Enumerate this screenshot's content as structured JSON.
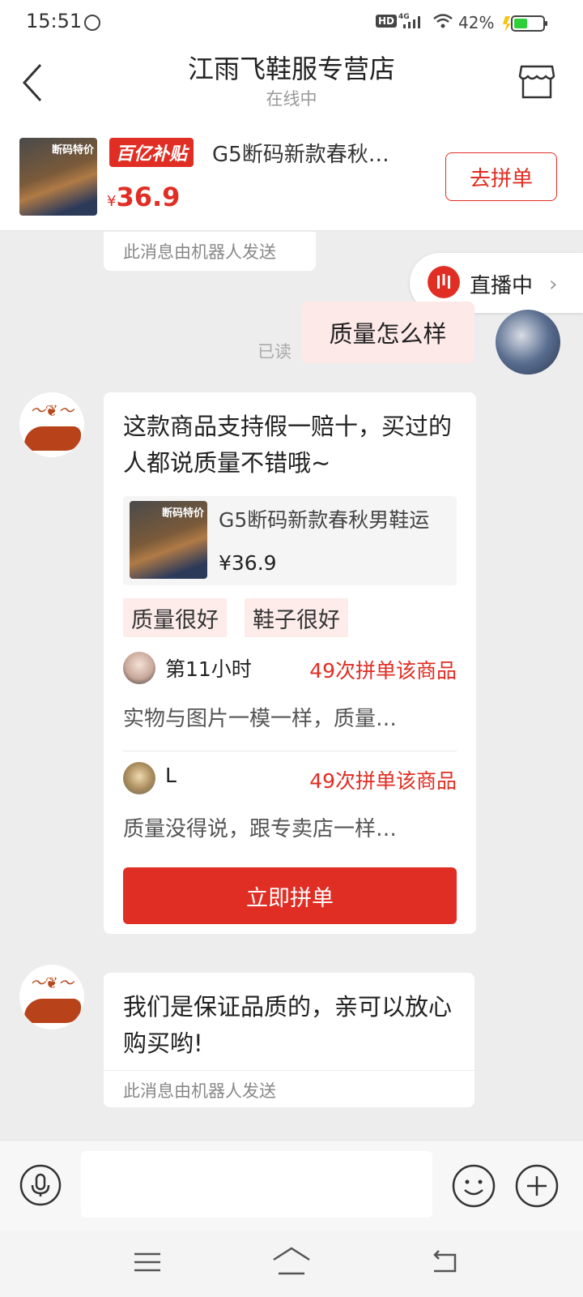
{
  "status_bar": {
    "time": "15:51",
    "network": "4G",
    "hd_label": "HD",
    "battery_percent": "42%"
  },
  "header": {
    "title": "江雨飞鞋服专营店",
    "subtitle": "在线中"
  },
  "product": {
    "thumb_tag": "断码特价",
    "badge": "百亿补贴",
    "title": "G5断码新款春秋…",
    "currency": "¥",
    "price": "36.9",
    "button_label": "去拼单"
  },
  "messages": {
    "robot_note": "此消息由机器人发送",
    "live": {
      "label": "直播中"
    },
    "my_message": {
      "text": "质量怎么样",
      "status": "已读"
    },
    "product_card": {
      "text": "这款商品支持假一赔十，买过的人都说质量不错哦~",
      "thumb_tag": "断码特价",
      "product_title": "G5断码新款春秋男鞋运",
      "product_price": "¥36.9",
      "tags": [
        "质量很好",
        "鞋子很好"
      ],
      "reviews": [
        {
          "name": "第11小时",
          "count": "49次拼单该商品",
          "text": "实物与图片一模一样，质量…"
        },
        {
          "name": "L",
          "count": "49次拼单该商品",
          "text": "质量没得说，跟专卖店一样…"
        }
      ],
      "buy_label": "立即拼单"
    },
    "reply": {
      "text": "我们是保证品质的，亲可以放心购买哟!",
      "note": "此消息由机器人发送"
    }
  },
  "input_bar": {
    "placeholder": ""
  },
  "colors": {
    "accent": "#e02e24",
    "chat_background": "#ededed",
    "my_bubble": "#fde9e8",
    "tag_background": "#fdecea"
  }
}
